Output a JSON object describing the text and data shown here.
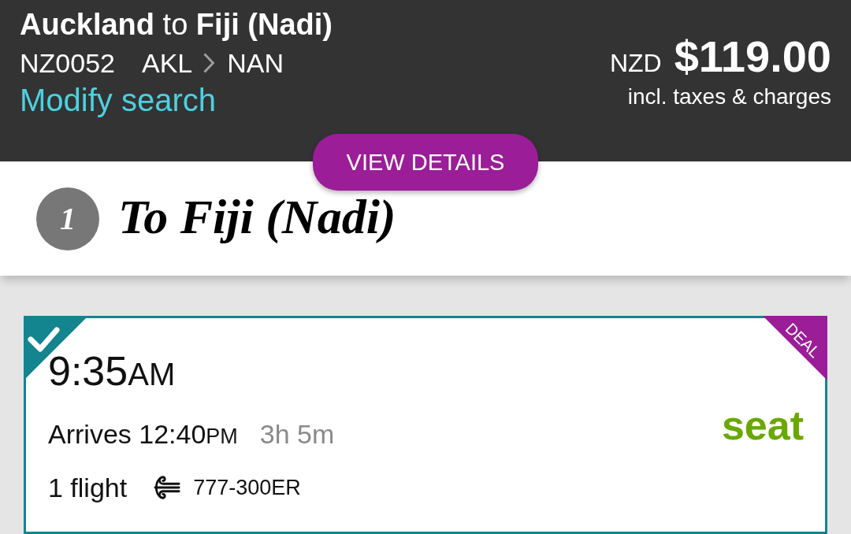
{
  "header": {
    "title": "**Auckland** to **Fiji (Nadi)**",
    "flight_number": "NZ0052",
    "origin": "AKL",
    "destination": "NAN",
    "modify_link": "Modify search",
    "currency": "NZD",
    "price": "$119.00",
    "price_note": "incl. taxes & charges"
  },
  "view_details_button": "VIEW DETAILS",
  "step": {
    "number": "1",
    "title": "To Fiji (Nadi)"
  },
  "flights": [
    {
      "selected": true,
      "badge": "DEAL",
      "departure_time": "9:35",
      "departure_period": "AM",
      "arrival": "Arrives 12:40",
      "arrival_period": "PM",
      "duration": "3h 5m",
      "stops": "1 flight",
      "aircraft": "777-300ER",
      "fare": "seat"
    }
  ]
}
